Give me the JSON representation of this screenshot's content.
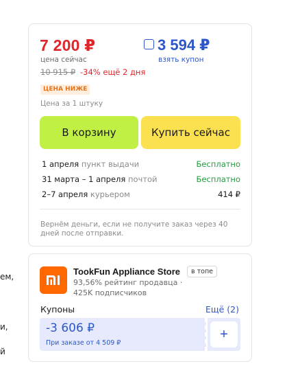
{
  "left_fragments": [
    "ем,",
    "и,",
    "й"
  ],
  "price": {
    "current": "7 200 ₽",
    "current_label": "цена сейчас",
    "coupon_price": "3 594 ₽",
    "coupon_label": "взять купон",
    "old": "10 915 ₽",
    "discount": "-34% ещё 2 дня",
    "badge": "ЦЕНА НИЖЕ",
    "per_unit": "Цена за 1 штуку"
  },
  "buttons": {
    "cart": "В корзину",
    "buy_now": "Купить сейчас"
  },
  "delivery": [
    {
      "date": "1 апреля",
      "method": "пункт выдачи",
      "cost": "Бесплатно",
      "free": true
    },
    {
      "date": "31 марта – 1 апреля",
      "method": "почтой",
      "cost": "Бесплатно",
      "free": true
    },
    {
      "date": "2–7 апреля",
      "method": "курьером",
      "cost": "414 ₽",
      "free": false
    }
  ],
  "refund_note": "Вернём деньги, если не получите заказ через 40 дней после отправки.",
  "store": {
    "logo_icon": "mi-logo-icon",
    "name": "TookFun Appliance Store",
    "top_badge": "в топе",
    "rating": "93,56% рейтинг продавца",
    "subscribers": "425K подписчиков"
  },
  "coupons": {
    "title": "Купоны",
    "more": "Ещё (2)",
    "amount": "-3 606 ₽",
    "condition": "При заказе от 4 509 ₽",
    "add_symbol": "+"
  },
  "colors": {
    "price_red": "#e0262b",
    "coupon_blue": "#2d57c9",
    "cart_green": "#c0f044",
    "buy_yellow": "#fbe04f",
    "free_green": "#1e9e3e",
    "brand_orange": "#ff6700"
  }
}
